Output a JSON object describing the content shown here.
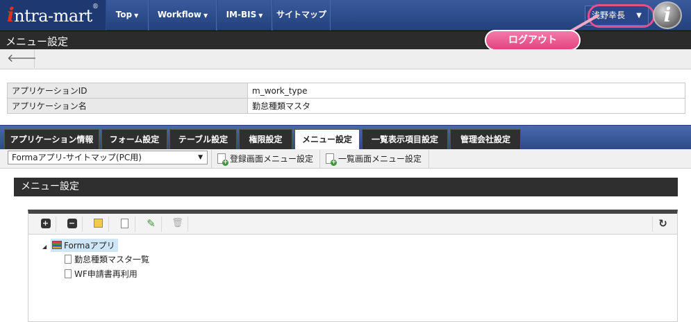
{
  "header": {
    "logo": "intra-mart",
    "nav": [
      {
        "label": "Top"
      },
      {
        "label": "Workflow"
      },
      {
        "label": "IM-BIS"
      },
      {
        "label": "サイトマップ"
      }
    ],
    "user_name": "浅野幸長",
    "logout_callout": "ログアウト",
    "im_logo": "i"
  },
  "page": {
    "title": "メニュー設定"
  },
  "app_info": {
    "rows": [
      {
        "label": "アプリケーションID",
        "value": "m_work_type"
      },
      {
        "label": "アプリケーション名",
        "value": "勤怠種類マスタ"
      }
    ]
  },
  "tabs": [
    {
      "label": "アプリケーション情報",
      "active": false
    },
    {
      "label": "フォーム設定",
      "active": false
    },
    {
      "label": "テーブル設定",
      "active": false
    },
    {
      "label": "権限設定",
      "active": false
    },
    {
      "label": "メニュー設定",
      "active": true
    },
    {
      "label": "一覧表示項目設定",
      "active": false
    },
    {
      "label": "管理会社設定",
      "active": false
    }
  ],
  "toolbar": {
    "site_map_select": "Formaアプリ-サイトマップ(PC用)",
    "register_menu_button": "登録画面メニュー設定",
    "list_menu_button": "一覧画面メニュー設定"
  },
  "section": {
    "title": "メニュー設定"
  },
  "tree": {
    "root": "Formaアプリ",
    "children": [
      "勤怠種類マスタ一覧",
      "WF申請書再利用"
    ]
  },
  "icons": {
    "back": "back-arrow-icon",
    "expand": "expand-plus-icon",
    "collapse": "collapse-minus-icon",
    "add_folder": "add-folder-icon",
    "add_page": "add-page-icon",
    "edit": "pencil-icon",
    "delete": "trash-icon",
    "refresh": "refresh-icon"
  },
  "colors": {
    "nav_bg": "#2c4a88",
    "title_bg": "#2b2b2b",
    "callout": "#e0457f",
    "tree_selected": "#cfe6f7"
  }
}
